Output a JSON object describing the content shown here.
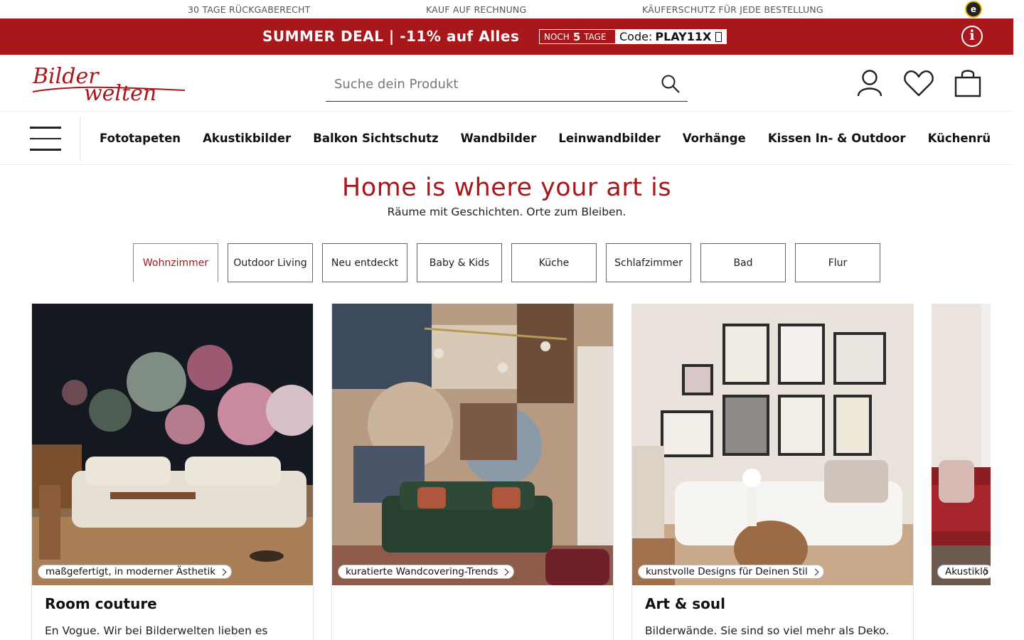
{
  "trustbar": {
    "items": [
      "30 TAGE RÜCKGABERECHT",
      "KAUF AUF RECHNUNG",
      "KÄUFERSCHUTZ FÜR JEDE BESTELLUNG"
    ],
    "seal": "e"
  },
  "promo": {
    "text": "SUMMER DEAL | -11% auf Alles",
    "countdown_prefix": "NOCH",
    "countdown_value": "5",
    "countdown_unit": "TAGE",
    "code_label": "Code:",
    "code_value": "PLAY11X",
    "info_glyph": "i"
  },
  "header": {
    "logo_top": "Bilder",
    "logo_bottom": "welten",
    "search_placeholder": "Suche dein Produkt"
  },
  "nav": {
    "items": [
      "Fototapeten",
      "Akustikbilder",
      "Balkon Sichtschutz",
      "Wandbilder",
      "Leinwandbilder",
      "Vorhänge",
      "Kissen In- & Outdoor",
      "Küchenrückwände"
    ]
  },
  "hero": {
    "headline": "Home is where your art is",
    "subline": "Räume mit Geschichten. Orte zum Bleiben."
  },
  "tabs": [
    "Wohnzimmer",
    "Outdoor Living",
    "Neu entdeckt",
    "Baby & Kids",
    "Küche",
    "Schlafzimmer",
    "Bad",
    "Flur"
  ],
  "active_tab": "Wohnzimmer",
  "cards": [
    {
      "pill": "maßgefertigt, in moderner Ästhetik",
      "title": "Room couture",
      "text": "En Vogue. Wir bei Bilderwelten lieben es"
    },
    {
      "pill": "kuratierte Wandcovering-Trends",
      "title": "",
      "text": ""
    },
    {
      "pill": "kunstvolle Designs für Deinen Stil",
      "title": "Art & soul",
      "text": "Bilderwände. Sie sind so viel mehr als Deko."
    },
    {
      "pill": "Akustiklö"
    }
  ],
  "colors": {
    "brand_red": "#a8171c",
    "text": "#111111"
  }
}
